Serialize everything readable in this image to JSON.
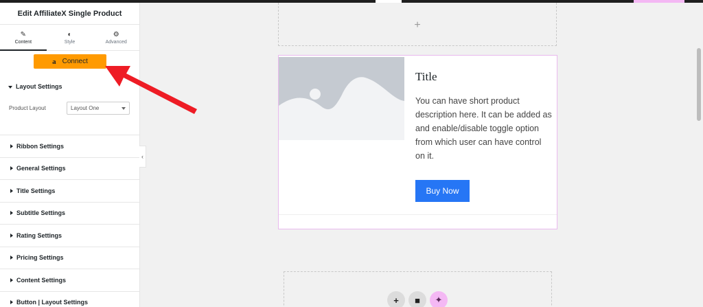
{
  "sidebar": {
    "title": "Edit AffiliateX Single Product",
    "tabs": [
      {
        "label": "Content",
        "icon": "pencil-icon"
      },
      {
        "label": "Style",
        "icon": "half-circle-icon"
      },
      {
        "label": "Advanced",
        "icon": "gear-icon"
      }
    ],
    "connect_label": "Connect",
    "connect_logo": "a",
    "layout_settings": {
      "label": "Layout Settings",
      "product_layout_label": "Product Layout",
      "product_layout_value": "Layout One"
    },
    "sections": [
      "Ribbon Settings",
      "General Settings",
      "Title Settings",
      "Subtitle Settings",
      "Rating Settings",
      "Pricing Settings",
      "Content Settings",
      "Button | Layout Settings"
    ],
    "collapse_glyph": "‹"
  },
  "canvas": {
    "add_glyph": "+",
    "product": {
      "title": "Title",
      "description": "You can have short product description here. It can be added as and enable/disable toggle option from which user can have control on it.",
      "button_label": "Buy Now"
    },
    "actions": {
      "add": "+",
      "folder": "■",
      "ai": "✦"
    }
  },
  "colors": {
    "connect_bg": "#ff9a00",
    "buy_button": "#2676f5",
    "selection_border": "#e9b9ee",
    "annotation_arrow": "#ee1c25"
  }
}
